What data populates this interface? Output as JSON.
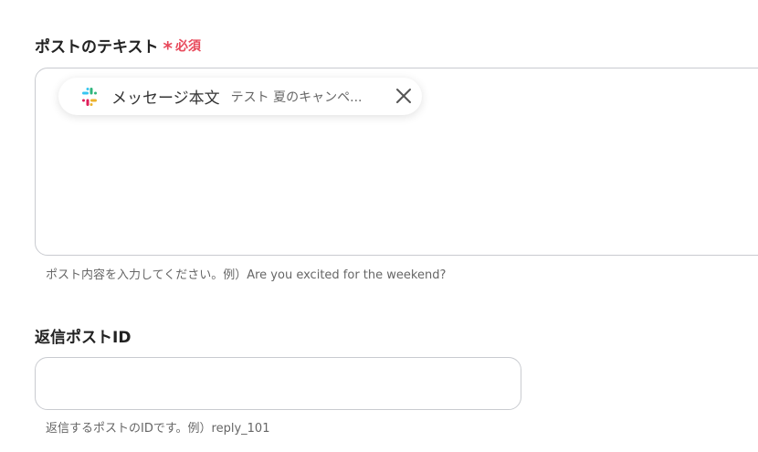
{
  "post_text_field": {
    "label": "ポストのテキスト",
    "required_mark": "*",
    "required_text": "必須",
    "chip": {
      "icon": "slack-icon",
      "name": "メッセージ本文",
      "value": "テスト 夏のキャンペ...",
      "close_icon": "close-icon"
    },
    "hint": "ポスト内容を入力してください。例）Are you excited for the weekend?"
  },
  "reply_post_id_field": {
    "label": "返信ポストID",
    "value": "",
    "placeholder": "",
    "hint": "返信するポストのIDです。例）reply_101"
  },
  "colors": {
    "required": "#e8495b",
    "border": "#c9cbd0",
    "slack_blue": "#36C5F0",
    "slack_green": "#2EB67D",
    "slack_yellow": "#ECB22E",
    "slack_red": "#E01E5A"
  }
}
